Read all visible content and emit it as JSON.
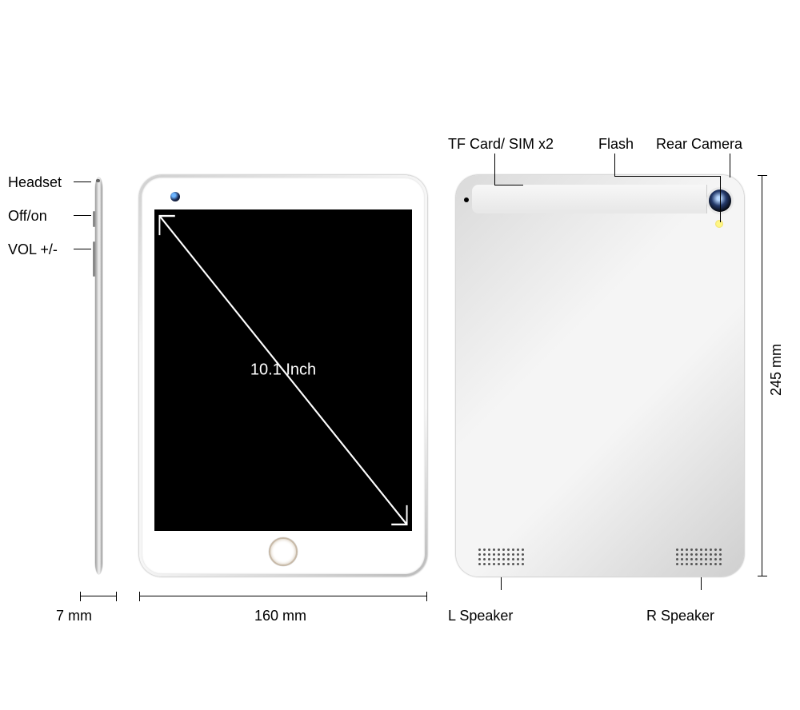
{
  "side_labels": {
    "headset": "Headset",
    "power": "Off/on",
    "volume": "VOL +/-"
  },
  "front": {
    "screen_size": "10.1 Inch"
  },
  "back_callouts": {
    "tf_sim": "TF Card/ SIM x2",
    "flash": "Flash",
    "rear_camera": "Rear Camera",
    "l_speaker": "L Speaker",
    "r_speaker": "R Speaker"
  },
  "dimensions": {
    "thickness": "7 mm",
    "width": "160 mm",
    "height": "245 mm"
  }
}
